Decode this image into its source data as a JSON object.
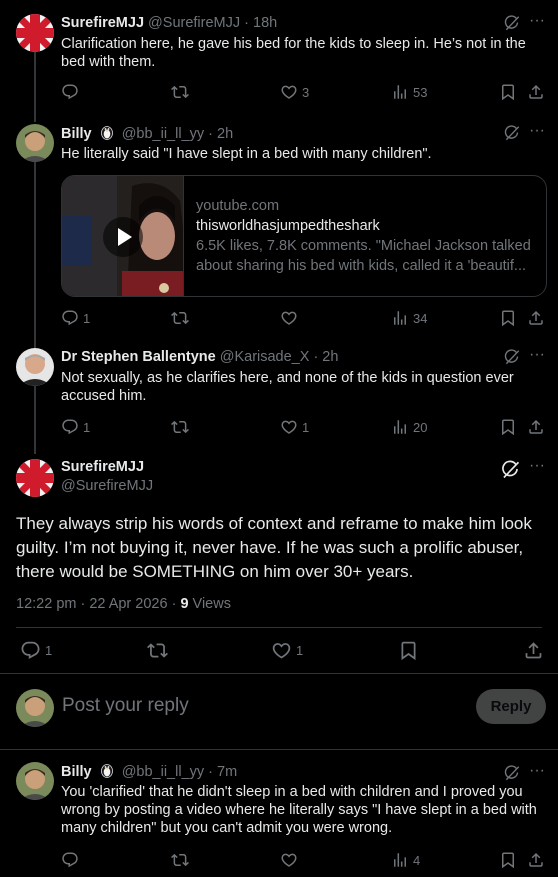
{
  "tweets": [
    {
      "name": "SurefireMJJ",
      "handle": "@SurefireMJJ",
      "time": "· 18h",
      "text": "Clarification here, he gave his bed for the kids to sleep in. He’s not in the bed with them.",
      "reply_count": "",
      "retweet_count": "",
      "like_count": "3",
      "view_count": "53"
    },
    {
      "name": "Billy",
      "handle": "@bb_ii_ll_yy",
      "time": "· 2h",
      "text": "He literally said \"I have slept in a bed with many children\".",
      "reply_count": "1",
      "retweet_count": "",
      "like_count": "",
      "view_count": "34",
      "card": {
        "domain": "youtube.com",
        "title": "thisworldhasjumpedtheshark",
        "desc1": "6.5K likes, 7.8K comments. \"Michael Jackson talked",
        "desc2": "about sharing his bed with kids, called it a 'beautif..."
      }
    },
    {
      "name": "Dr Stephen Ballentyne",
      "handle": "@Karisade_X",
      "time": "· 2h",
      "text": "Not sexually, as he clarifies here, and none of the kids in question ever accused him.",
      "reply_count": "1",
      "retweet_count": "",
      "like_count": "1",
      "view_count": "20"
    }
  ],
  "focus": {
    "name": "SurefireMJJ",
    "handle": "@SurefireMJJ",
    "text": "They always strip his words of context and reframe to make him look guilty. I’m not buying it, never have. If he was such a prolific abuser, there would be SOMETHING on him over 30+ years.",
    "time": "12:22 pm · 22 Apr 2026 · ",
    "views_count": "9",
    "views_label": " Views",
    "reply_count": "1",
    "like_count": "1"
  },
  "reply_box": {
    "placeholder": "Post your reply",
    "button": "Reply"
  },
  "last_reply": {
    "name": "Billy",
    "handle": "@bb_ii_ll_yy",
    "time": "· 7m",
    "text": "You 'clarified' that he didn't sleep in a bed with children and I proved you wrong by posting a video where he literally says \"I have slept in a bed with many children\" but you can't admit you were wrong.",
    "view_count": "4"
  },
  "colors": {
    "background": "#000000",
    "text": "#e7e9ea",
    "secondary": "#71767b",
    "border": "#2f3336"
  }
}
